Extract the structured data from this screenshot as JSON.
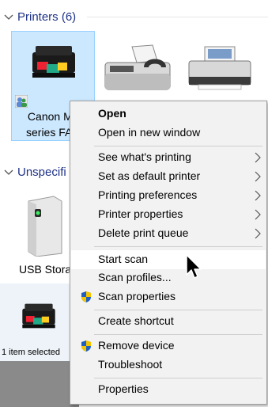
{
  "groups": {
    "printers_header": "Printers (6)",
    "unspecified_header": "Unspecifi"
  },
  "devices": {
    "canon_label_line1": "Canon MX",
    "canon_label_line2": "series FA",
    "usb_label": "USB Stora",
    "canon_icon": "printer-color-icon",
    "fax_icon": "fax-machine-icon",
    "printer2_icon": "printer-icon",
    "usb_icon": "usb-storage-icon"
  },
  "status": {
    "selection": "1 item selected"
  },
  "context_menu": {
    "open": "Open",
    "open_new_window": "Open in new window",
    "see_printing": "See what's printing",
    "set_default": "Set as default printer",
    "printing_prefs": "Printing preferences",
    "printer_props": "Printer properties",
    "delete_queue": "Delete print queue",
    "start_scan": "Start scan",
    "scan_profiles": "Scan profiles...",
    "scan_props": "Scan properties",
    "create_shortcut": "Create shortcut",
    "remove_device": "Remove device",
    "troubleshoot": "Troubleshoot",
    "properties": "Properties"
  },
  "colors": {
    "header_text": "#1e3287",
    "selection_bg": "#cce8ff",
    "menu_bg": "#f2f2f2",
    "shield_blue": "#1f5fbf",
    "shield_yellow": "#f5c400"
  }
}
